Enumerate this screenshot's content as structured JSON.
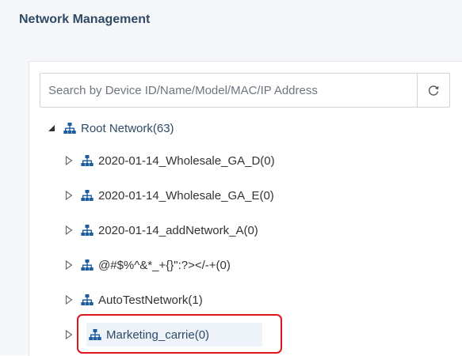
{
  "header": {
    "title": "Network Management"
  },
  "search": {
    "placeholder": "Search by Device ID/Name/Model/MAC/IP Address"
  },
  "tree": {
    "root": {
      "label": "Root Network(63)",
      "expanded": true
    },
    "children": [
      {
        "label": "2020-01-14_Wholesale_GA_D(0)"
      },
      {
        "label": "2020-01-14_Wholesale_GA_E(0)"
      },
      {
        "label": "2020-01-14_addNetwork_A(0)"
      },
      {
        "label": "@#$%^&*_+{}\":?></-+(0)"
      },
      {
        "label": "AutoTestNetwork(1)"
      },
      {
        "label": "Marketing_carrie(0)",
        "highlighted": true
      }
    ]
  },
  "icons": {
    "network": "network-tree-icon",
    "refresh": "refresh-icon",
    "expanded": "caret-down-icon",
    "collapsed": "caret-right-icon"
  },
  "colors": {
    "title": "#2f4a66",
    "network_icon": "#1f5e9e",
    "highlight": "#e0141b"
  }
}
